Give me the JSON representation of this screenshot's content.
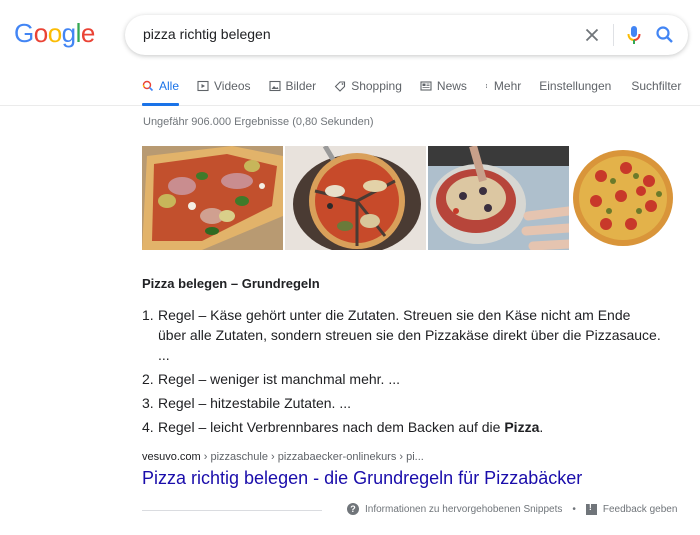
{
  "logo": {
    "letters": [
      {
        "char": "G",
        "color": "#4285f4"
      },
      {
        "char": "o",
        "color": "#ea4335"
      },
      {
        "char": "o",
        "color": "#fbbc05"
      },
      {
        "char": "g",
        "color": "#4285f4"
      },
      {
        "char": "l",
        "color": "#34a853"
      },
      {
        "char": "e",
        "color": "#ea4335"
      }
    ]
  },
  "search": {
    "query": "pizza richtig belegen",
    "clear_icon": "close-icon",
    "mic_icon": "microphone-icon",
    "search_icon": "search-icon"
  },
  "tabs": [
    {
      "label": "Alle",
      "icon": "search-icon",
      "active": true
    },
    {
      "label": "Videos",
      "icon": "video-icon"
    },
    {
      "label": "Bilder",
      "icon": "image-icon"
    },
    {
      "label": "Shopping",
      "icon": "tag-icon"
    },
    {
      "label": "News",
      "icon": "newspaper-icon"
    },
    {
      "label": "Mehr",
      "icon": "more-vert-icon"
    },
    {
      "label": "Einstellungen"
    },
    {
      "label": "Suchfilter"
    }
  ],
  "stats": "Ungefähr 906.000 Ergebnisse (0,80 Sekunden)",
  "images": [
    {
      "alt": "Pizza mit Schinken, Artischocken und Basilikum"
    },
    {
      "alt": "Geschnittene Pizza auf Holzbrett"
    },
    {
      "alt": "Pizza wird belegt"
    },
    {
      "alt": "Salami-Pizza"
    }
  ],
  "snippet": {
    "title": "Pizza belegen – Grundregeln",
    "rules": [
      {
        "num": "1.",
        "text": "Regel – Käse gehört unter die Zutaten. Streuen sie den Käse nicht am Ende über alle Zutaten, sondern streuen sie den Pizzakäse direkt über die Pizzasauce. ..."
      },
      {
        "num": "2.",
        "text": "Regel – weniger ist manchmal mehr. ..."
      },
      {
        "num": "3.",
        "text": "Regel – hitzestabile Zutaten. ..."
      },
      {
        "num": "4.",
        "text_before": "Regel – leicht Verbrennbares nach dem Backen auf die ",
        "text_bold": "Pizza",
        "text_after": "."
      }
    ]
  },
  "result": {
    "domain": "vesuvo.com",
    "path": " › pizzaschule › pizzabaecker-onlinekurs › pi...",
    "title": "Pizza richtig belegen - die Grundregeln für Pizzabäcker"
  },
  "footer": {
    "info_label": "Informationen zu hervorgehobenen Snippets",
    "separator": "•",
    "feedback_label": "Feedback geben"
  },
  "colors": {
    "accent": "#1a73e8",
    "link": "#1a0dab",
    "muted": "#70757a"
  }
}
